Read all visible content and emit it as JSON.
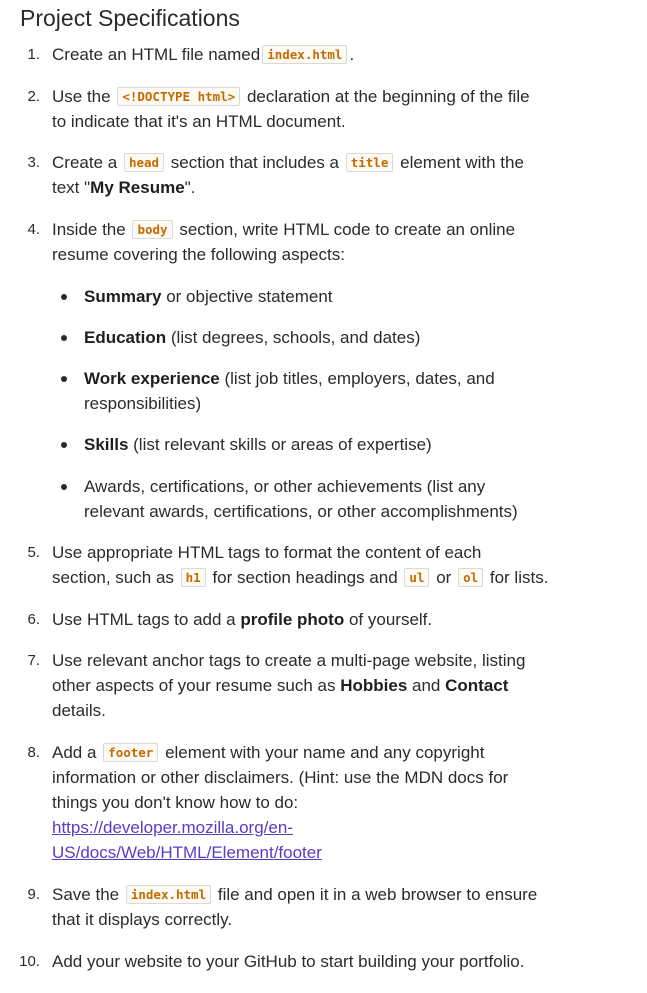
{
  "title": "Project Specifications",
  "items": [
    {
      "number": "1.",
      "before": "Create an HTML file named",
      "code": "index.html",
      "after": "."
    },
    {
      "number": "2.",
      "before": "Use the",
      "code": "<!DOCTYPE html>",
      "after": "declaration at the beginning of the file",
      "line2": "to indicate that it's an HTML document."
    },
    {
      "number": "3.",
      "before": "Create a",
      "code1": "head",
      "middle": "section that includes a",
      "code2": "title",
      "after": "element with the",
      "line2_before": "text \"",
      "line2_bold": "My Resume",
      "line2_after": "\"."
    },
    {
      "number": "4.",
      "before": "Inside the",
      "code": "body",
      "after": "section, write HTML code to create an online",
      "line2": "resume covering the following aspects:",
      "bullets": [
        {
          "bold": "Summary",
          "text": " or objective statement"
        },
        {
          "bold": "Education",
          "text": " (list degrees, schools, and dates)"
        },
        {
          "bold": "Work experience",
          "text": " (list job titles, employers, dates, and",
          "line2": "responsibilities)"
        },
        {
          "bold": "Skills",
          "text": " (list relevant skills or areas of expertise)"
        },
        {
          "bold": "",
          "text": "Awards, certifications, or other achievements (list any",
          "line2": "relevant awards, certifications, or other accomplishments)"
        }
      ]
    },
    {
      "number": "5.",
      "line1": "Use appropriate HTML tags to format the content of each",
      "before": "section, such as",
      "code1": "h1",
      "middle": "for section headings and",
      "code2": "ul",
      "or": "or",
      "code3": "ol",
      "after": "for lists."
    },
    {
      "number": "6.",
      "before": "Use HTML tags to add a",
      "bold": "profile photo",
      "after": "of yourself."
    },
    {
      "number": "7.",
      "line1": "Use relevant anchor tags to create a multi-page website, listing",
      "before": "other aspects of your resume such as",
      "bold1": "Hobbies",
      "and": "and",
      "bold2": "Contact",
      "line3": "details."
    },
    {
      "number": "8.",
      "before": "Add a",
      "code": "footer",
      "after": "element with your name and any copyright",
      "line2": "information or other disclaimers. (Hint: use the MDN docs for",
      "line3": "things you don't know how to do:",
      "link1": "https://developer.mozilla.org/en-",
      "link2": "US/docs/Web/HTML/Element/footer"
    },
    {
      "number": "9.",
      "before": "Save the",
      "code": "index.html",
      "after": "file and open it in a web browser to ensure",
      "line2": "that it displays correctly."
    },
    {
      "number": "10.",
      "text": "Add your website to your GitHub to start building your portfolio."
    }
  ]
}
